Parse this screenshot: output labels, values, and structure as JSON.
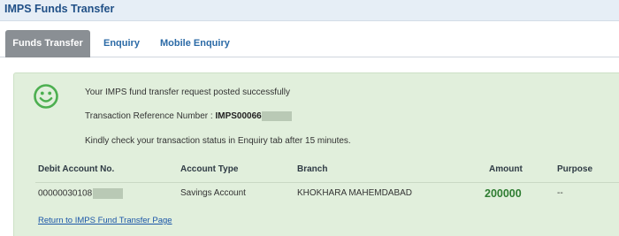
{
  "page": {
    "title": "IMPS Funds Transfer"
  },
  "tabs": [
    {
      "label": "Funds Transfer",
      "active": true
    },
    {
      "label": "Enquiry",
      "active": false
    },
    {
      "label": "Mobile Enquiry",
      "active": false
    }
  ],
  "result": {
    "status_icon": "smiley-icon",
    "success_message": "Your IMPS fund transfer request posted successfully",
    "ref_label": "Transaction Reference Number : ",
    "ref_value": "IMPS00066",
    "check_message": "Kindly check your transaction status in Enquiry tab after 15 minutes."
  },
  "table": {
    "headers": [
      "Debit Account No.",
      "Account Type",
      "Branch",
      "Amount",
      "Purpose"
    ],
    "row": {
      "account": "00000030108",
      "account_type": "Savings Account",
      "branch": "KHOKHARA MAHEMDABAD",
      "amount": "200000",
      "purpose": "--"
    }
  },
  "return_link": "Return to IMPS Fund Transfer Page",
  "colors": {
    "header_bg": "#e6eef6",
    "panel_bg": "#e1efdc",
    "success_green": "#2f7d32",
    "active_tab": "#8a8f94",
    "link_blue": "#1b56a8"
  }
}
